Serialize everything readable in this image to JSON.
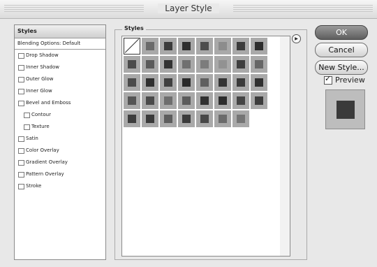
{
  "window": {
    "title": "Layer Style"
  },
  "sidebar": {
    "header": "Styles",
    "default_label": "Blending Options: Default",
    "items": [
      {
        "label": "Drop Shadow",
        "sub": false
      },
      {
        "label": "Inner Shadow",
        "sub": false
      },
      {
        "label": "Outer Glow",
        "sub": false
      },
      {
        "label": "Inner Glow",
        "sub": false
      },
      {
        "label": "Bevel and Emboss",
        "sub": false
      },
      {
        "label": "Contour",
        "sub": true
      },
      {
        "label": "Texture",
        "sub": true
      },
      {
        "label": "Satin",
        "sub": false
      },
      {
        "label": "Color Overlay",
        "sub": false
      },
      {
        "label": "Gradient Overlay",
        "sub": false
      },
      {
        "label": "Pattern Overlay",
        "sub": false
      },
      {
        "label": "Stroke",
        "sub": false
      }
    ]
  },
  "styles_panel": {
    "legend": "Styles",
    "flyout_icon": "triangle-right-icon",
    "rows": [
      [
        "none",
        "#6a6a6a",
        "#3c3c3c",
        "#2e2e2e",
        "#4d4d4d",
        "#8c8c8c",
        "#3b3b3b",
        "#2d2d2d"
      ],
      [
        "#4c4c4c",
        "#5a5a5a",
        "#333333",
        "#707070",
        "#7c7c7c",
        "#929292",
        "#3f3f3f",
        "#666666"
      ],
      [
        "#4b4b4b",
        "#2f2f2f",
        "#404040",
        "#2a2a2a",
        "#5f5f5f",
        "#343434",
        "#3a3a3a",
        "#303030"
      ],
      [
        "#555555",
        "#4a4a4a",
        "#6e6e6e",
        "#5b5b5b",
        "#303030",
        "#2c2c2c",
        "#444444",
        "#3c3c3c"
      ],
      [
        "#3e3e3e",
        "#3a3a3a",
        "#5d5d5d",
        "#3b3b3b",
        "#484848",
        "#6b6b6b",
        "#757575"
      ]
    ]
  },
  "buttons": {
    "ok": "OK",
    "cancel": "Cancel",
    "new_style": "New Style..."
  },
  "preview": {
    "label": "Preview",
    "checked": true
  }
}
